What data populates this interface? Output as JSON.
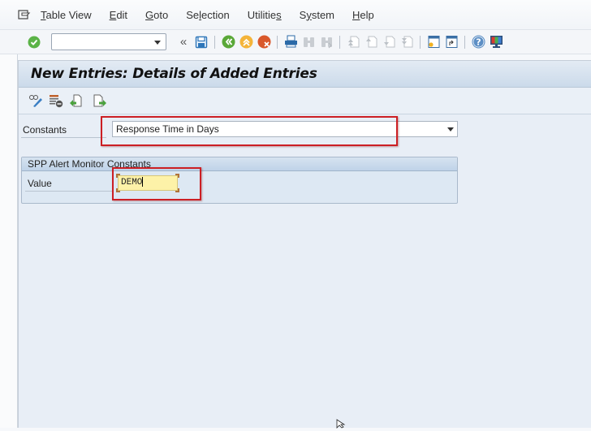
{
  "menubar": {
    "items": [
      {
        "label": "Table View",
        "mnemonic": "T"
      },
      {
        "label": "Edit",
        "mnemonic": "E"
      },
      {
        "label": "Goto",
        "mnemonic": "G"
      },
      {
        "label": "Selection",
        "mnemonic": "l"
      },
      {
        "label": "Utilities",
        "mnemonic": "s"
      },
      {
        "label": "System",
        "mnemonic": "y"
      },
      {
        "label": "Help",
        "mnemonic": "H"
      }
    ]
  },
  "toolbar": {
    "command_field": {
      "value": "",
      "placeholder": ""
    },
    "icons": [
      "enter-icon",
      "collapse-icon",
      "save-icon",
      "back-icon",
      "exit-icon",
      "cancel-icon",
      "print-icon",
      "find-icon",
      "find-next-icon",
      "first-page-icon",
      "previous-page-icon",
      "next-page-icon",
      "last-page-icon",
      "create-session-icon",
      "shortcut-icon",
      "help-icon",
      "customize-layout-icon"
    ],
    "collapse_glyph": "«"
  },
  "screen": {
    "title": "New Entries: Details of Added Entries",
    "app_toolbar_icons": [
      "display-change-icon",
      "delete-icon",
      "previous-entry-icon",
      "next-entry-icon"
    ]
  },
  "form": {
    "constants_label": "Constants",
    "constants_value": "Response Time in Days",
    "group_title": "SPP Alert Monitor Constants",
    "value_label": "Value",
    "value_input": "DEMO"
  },
  "colors": {
    "highlight": "#cc1f24",
    "input_focus": "#fdf2a8",
    "content_bg": "#e8eef6"
  }
}
